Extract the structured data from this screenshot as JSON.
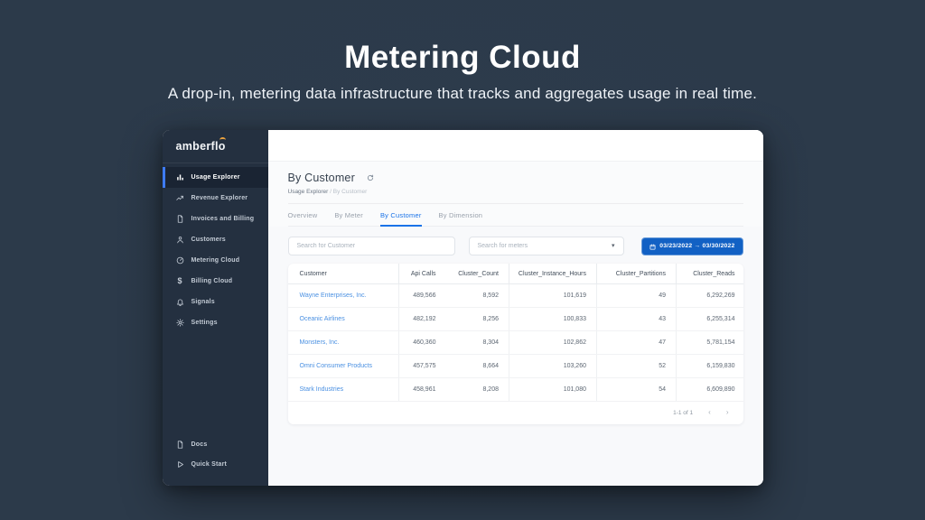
{
  "hero": {
    "title": "Metering Cloud",
    "subtitle": "A drop-in, metering data infrastructure that tracks and aggregates usage in real time."
  },
  "colors": {
    "background": "#2c3a4a",
    "sidebar_bg": "#243040",
    "sidebar_active_bg": "#1a2433",
    "sidebar_active_bar": "#3e7bfa",
    "brand_amber": "#eca23e",
    "tab_active_blue": "#1a73e8",
    "link_blue": "#4a90e2",
    "date_button_bg": "#1261c4"
  },
  "app": {
    "logo": {
      "text": "amberflo"
    },
    "sidebar": {
      "items": [
        {
          "label": "Usage Explorer",
          "icon": "bar-chart-icon",
          "active": true
        },
        {
          "label": "Revenue Explorer",
          "icon": "trending-up-icon",
          "active": false
        },
        {
          "label": "Invoices and Billing",
          "icon": "document-icon",
          "active": false
        },
        {
          "label": "Customers",
          "icon": "person-icon",
          "active": false
        },
        {
          "label": "Metering Cloud",
          "icon": "gauge-icon",
          "active": false
        },
        {
          "label": "Billing Cloud",
          "icon": "dollar-icon",
          "active": false
        },
        {
          "label": "Signals",
          "icon": "bell-icon",
          "active": false
        },
        {
          "label": "Settings",
          "icon": "gear-icon",
          "active": false
        }
      ],
      "footer_items": [
        {
          "label": "Docs",
          "icon": "document-icon"
        },
        {
          "label": "Quick Start",
          "icon": "play-icon"
        }
      ]
    },
    "page": {
      "title": "By Customer",
      "refresh_icon": "refresh-icon",
      "breadcrumb": {
        "parent": "Usage Explorer",
        "separator": "/",
        "current": "By Customer"
      },
      "tabs": [
        {
          "label": "Overview",
          "active": false
        },
        {
          "label": "By Meter",
          "active": false
        },
        {
          "label": "By Customer",
          "active": true
        },
        {
          "label": "By Dimension",
          "active": false
        }
      ],
      "filters": {
        "customer_search_placeholder": "Search for Customer",
        "meter_search_placeholder": "Search for meters",
        "date_range": "03/23/2022 → 03/30/2022",
        "date_icon": "calendar-icon"
      },
      "table": {
        "columns": [
          "Customer",
          "Api Calls",
          "Cluster_Count",
          "Cluster_Instance_Hours",
          "Cluster_Partitions",
          "Cluster_Reads"
        ],
        "rows": [
          [
            "Wayne Enterprises, Inc.",
            "489,566",
            "8,592",
            "101,619",
            "49",
            "6,292,269"
          ],
          [
            "Oceanic Airlines",
            "482,192",
            "8,256",
            "100,833",
            "43",
            "6,255,314"
          ],
          [
            "Monsters, Inc.",
            "460,360",
            "8,304",
            "102,862",
            "47",
            "5,781,154"
          ],
          [
            "Omni Consumer Products",
            "457,575",
            "8,664",
            "103,260",
            "52",
            "6,159,830"
          ],
          [
            "Stark Industries",
            "458,961",
            "8,208",
            "101,080",
            "54",
            "6,609,890"
          ]
        ],
        "pagination": "1-1 of 1"
      }
    }
  }
}
